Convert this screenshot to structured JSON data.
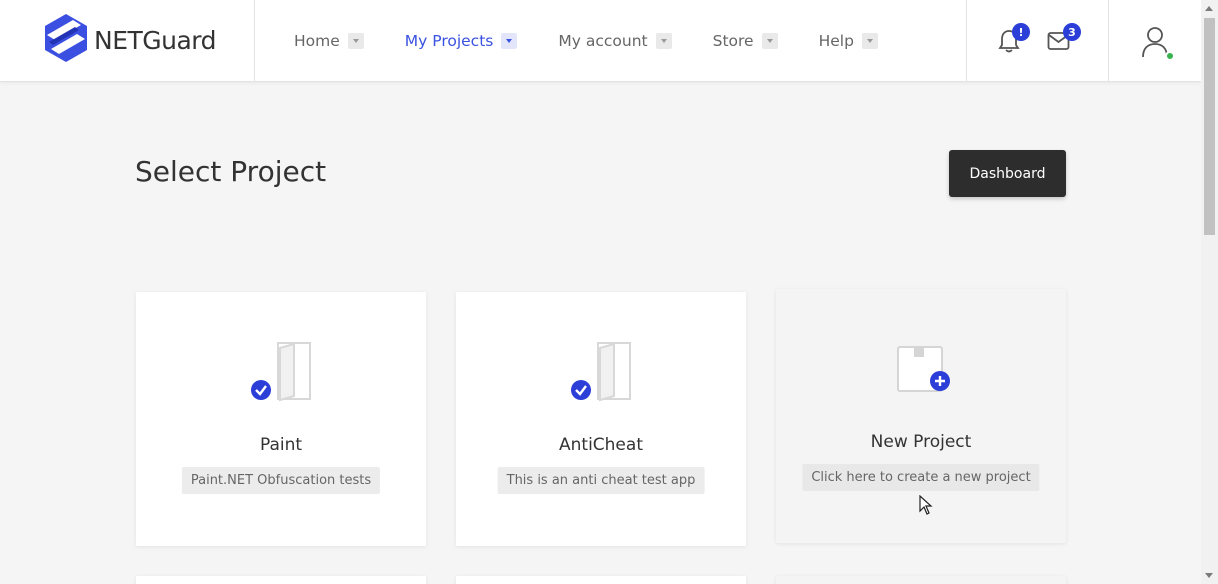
{
  "brand": {
    "name": "NETGuard"
  },
  "nav": {
    "items": [
      {
        "label": "Home",
        "active": false
      },
      {
        "label": "My Projects",
        "active": true
      },
      {
        "label": "My account",
        "active": false
      },
      {
        "label": "Store",
        "active": false
      },
      {
        "label": "Help",
        "active": false
      }
    ]
  },
  "header": {
    "notifications_badge": "!",
    "messages_badge": "3"
  },
  "page": {
    "title": "Select Project",
    "dashboard_label": "Dashboard"
  },
  "projects": [
    {
      "name": "Paint",
      "description": "Paint.NET Obfuscation tests",
      "icon": "door-check-icon"
    },
    {
      "name": "AntiCheat",
      "description": "This is an anti cheat test app",
      "icon": "door-check-icon"
    },
    {
      "name": "New Project",
      "description": "Click here to create a new project",
      "icon": "new-file-plus-icon"
    }
  ],
  "colors": {
    "accent": "#3a52e0",
    "badge": "#2b3fd8",
    "online": "#37b24d",
    "button_dark": "#2d2d2d"
  }
}
